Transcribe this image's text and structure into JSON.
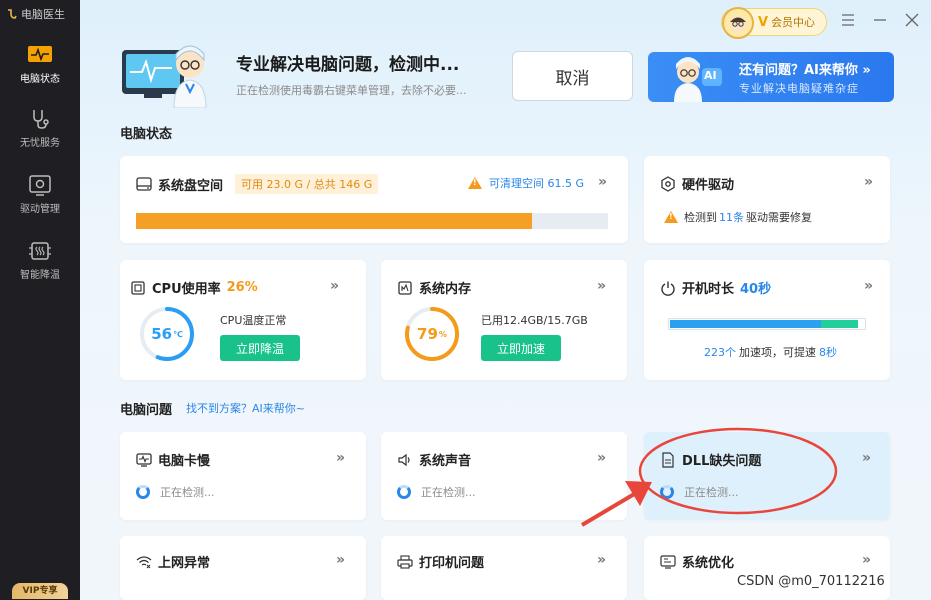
{
  "app": {
    "title": "电脑医生"
  },
  "sidebar": {
    "items": [
      {
        "label": "电脑状态",
        "icon": "pulse-monitor-icon"
      },
      {
        "label": "无忧服务",
        "icon": "stethoscope-icon"
      },
      {
        "label": "驱动管理",
        "icon": "driver-chip-icon"
      },
      {
        "label": "智能降温",
        "icon": "cooling-chip-icon"
      }
    ],
    "vip_label": "VIP专享"
  },
  "topbar": {
    "member_label": "会员中心",
    "member_v": "V"
  },
  "hero": {
    "title": "专业解决电脑问题，检测中...",
    "subtitle": "正在检测使用毒霸右键菜单管理，去除不必要...",
    "cancel_label": "取消",
    "ai_banner_title": "还有问题？AI来帮你 »",
    "ai_banner_sub": "专业解决电脑疑难杂症",
    "ai_badge": "AI"
  },
  "status_section": {
    "title": "电脑状态"
  },
  "disk": {
    "title": "系统盘空间",
    "available": "可用 23.0 G / 总共 146 G",
    "cleanable": "可清理空间 61.5 G",
    "used_fraction": 0.84,
    "bar_color": "#f5a024"
  },
  "hardware": {
    "title": "硬件驱动",
    "desc_prefix": "检测到",
    "count": "11条",
    "desc_suffix": "驱动需要修复"
  },
  "cpu": {
    "title": "CPU使用率",
    "usage": "26%",
    "temp": "56",
    "temp_unit": "℃",
    "temp_fraction": 0.56,
    "status": "CPU温度正常",
    "button": "立即降温"
  },
  "memory": {
    "title": "系统内存",
    "percent": "79",
    "percent_unit": "%",
    "percent_fraction": 0.79,
    "used": "已用12.4GB/15.7GB",
    "button": "立即加速"
  },
  "boot": {
    "title": "开机时长",
    "time": "40秒",
    "items_count": "223个",
    "items_text": "加速项，可提速",
    "speedup": "8秒",
    "blue_fraction": 0.78,
    "green_fraction": 0.19
  },
  "problems_section": {
    "title": "电脑问题",
    "link": "找不到方案？AI来帮你~"
  },
  "problem_cards": [
    {
      "title": "电脑卡慢",
      "status": "正在检测...",
      "icon": "monitor-pulse-icon"
    },
    {
      "title": "系统声音",
      "status": "正在检测...",
      "icon": "speaker-icon"
    },
    {
      "title": "DLL缺失问题",
      "status": "正在检测...",
      "icon": "dll-file-icon"
    },
    {
      "title": "上网异常",
      "status": "",
      "icon": "wifi-error-icon"
    },
    {
      "title": "打印机问题",
      "status": "",
      "icon": "printer-icon"
    },
    {
      "title": "系统优化",
      "status": "",
      "icon": "system-optimize-icon"
    }
  ],
  "watermark": "CSDN @m0_70112216",
  "colors": {
    "accent": "#2a86e8",
    "green": "#19c28a",
    "orange": "#f5a024",
    "annotation": "#e8463a"
  }
}
